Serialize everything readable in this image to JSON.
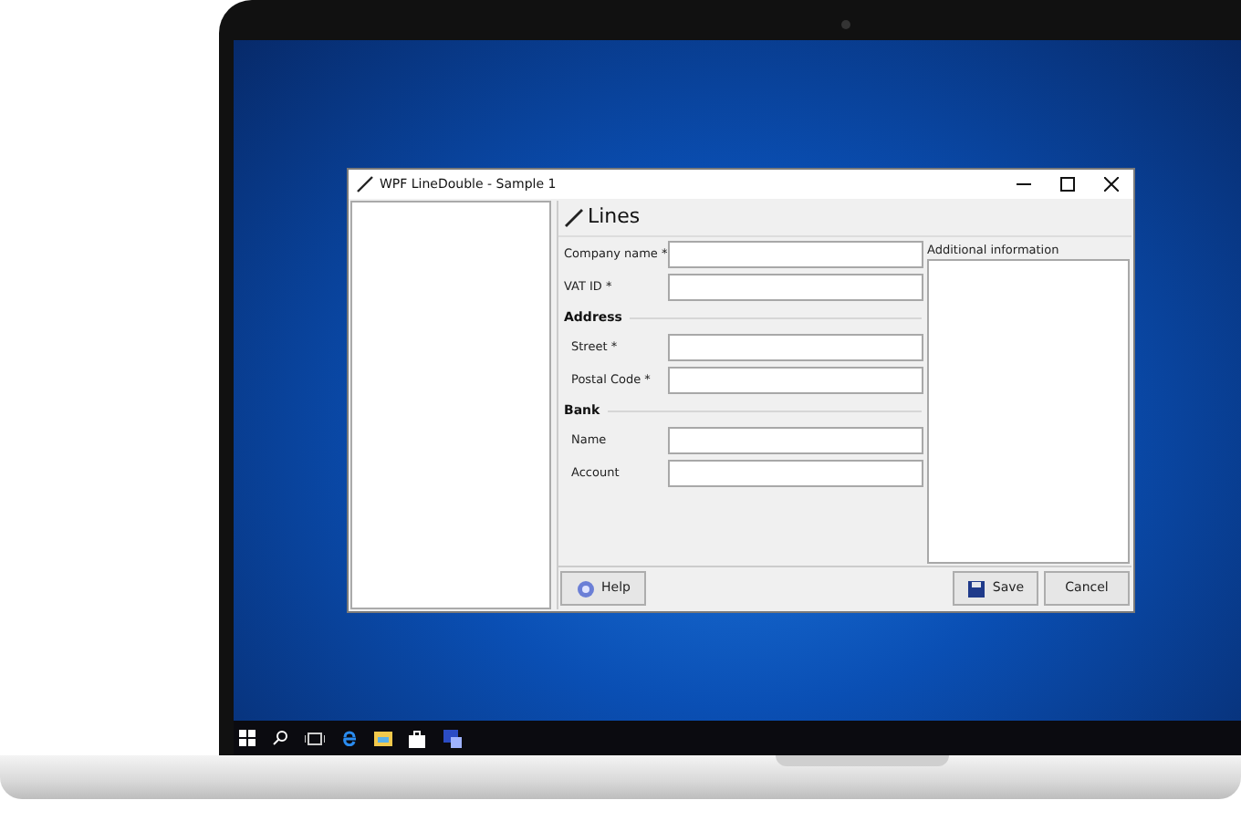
{
  "window": {
    "title": "WPF LineDouble - Sample 1"
  },
  "header": {
    "title": "Lines"
  },
  "form": [
    {
      "kind": "field",
      "label": "Company name *"
    },
    {
      "kind": "field",
      "label": "VAT ID *"
    },
    {
      "kind": "section",
      "label": "Address"
    },
    {
      "kind": "subfield",
      "label": "Street *"
    },
    {
      "kind": "subfield",
      "label": "Postal Code *"
    },
    {
      "kind": "section",
      "label": "Bank"
    },
    {
      "kind": "subfield",
      "label": "Name"
    },
    {
      "kind": "subfield",
      "label": "Account"
    }
  ],
  "additional_info": {
    "label": "Additional information"
  },
  "buttons": [
    {
      "kind": "help",
      "label": "Help"
    },
    {
      "kind": "save",
      "label": "Save"
    },
    {
      "kind": "cancel",
      "label": "Cancel"
    }
  ]
}
